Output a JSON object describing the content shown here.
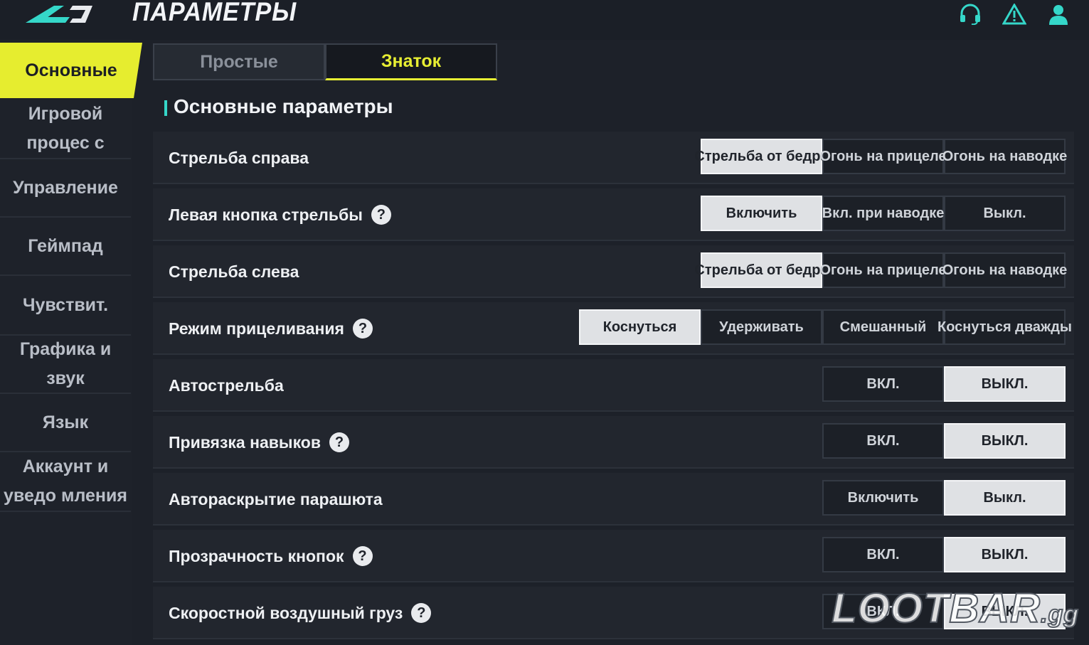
{
  "header": {
    "title": "ПАРАМЕТРЫ",
    "icons": [
      "headset-icon",
      "warning-icon",
      "user-icon"
    ],
    "accent_color": "#35d7c9"
  },
  "sidebar": {
    "items": [
      {
        "label": "Основные",
        "active": true
      },
      {
        "label": "Игровой процес с",
        "active": false
      },
      {
        "label": "Управление",
        "active": false
      },
      {
        "label": "Геймпад",
        "active": false
      },
      {
        "label": "Чувствит.",
        "active": false
      },
      {
        "label": "Графика и звук",
        "active": false
      },
      {
        "label": "Язык",
        "active": false
      },
      {
        "label": "Аккаунт и уведо мления",
        "active": false
      }
    ],
    "active_color": "#e6ed2f"
  },
  "tabs": [
    {
      "label": "Простые",
      "active": false
    },
    {
      "label": "Знаток",
      "active": true
    }
  ],
  "section": {
    "title": "Основные параметры"
  },
  "settings": [
    {
      "label": "Стрельба справа",
      "help": false,
      "options": [
        "Стрельба от бедра",
        "Огонь на прицеле",
        "Огонь на наводке"
      ],
      "selected": 0
    },
    {
      "label": "Левая кнопка стрельбы",
      "help": true,
      "options": [
        "Включить",
        "Вкл. при наводке",
        "Выкл."
      ],
      "selected": 0
    },
    {
      "label": "Стрельба слева",
      "help": false,
      "options": [
        "Стрельба от бедра",
        "Огонь на прицеле",
        "Огонь на наводке"
      ],
      "selected": 0
    },
    {
      "label": "Режим прицеливания",
      "help": true,
      "options": [
        "Коснуться",
        "Удерживать",
        "Смешанный",
        "Коснуться дважды"
      ],
      "selected": 0
    },
    {
      "label": "Автострельба",
      "help": false,
      "options": [
        "ВКЛ.",
        "ВЫКЛ."
      ],
      "selected": 1
    },
    {
      "label": "Привязка навыков",
      "help": true,
      "options": [
        "ВКЛ.",
        "ВЫКЛ."
      ],
      "selected": 1
    },
    {
      "label": "Автораскрытие парашюта",
      "help": false,
      "options": [
        "Включить",
        "Выкл."
      ],
      "selected": 1
    },
    {
      "label": "Прозрачность кнопок",
      "help": true,
      "options": [
        "ВКЛ.",
        "ВЫКЛ."
      ],
      "selected": 1
    },
    {
      "label": "Скоростной воздушный груз",
      "help": true,
      "options": [
        "ВКЛ.",
        "ВЫКЛ."
      ],
      "selected": 1
    }
  ],
  "help_glyph": "?",
  "watermark": {
    "text": "LOOTBAR",
    "suffix": ".gg"
  }
}
